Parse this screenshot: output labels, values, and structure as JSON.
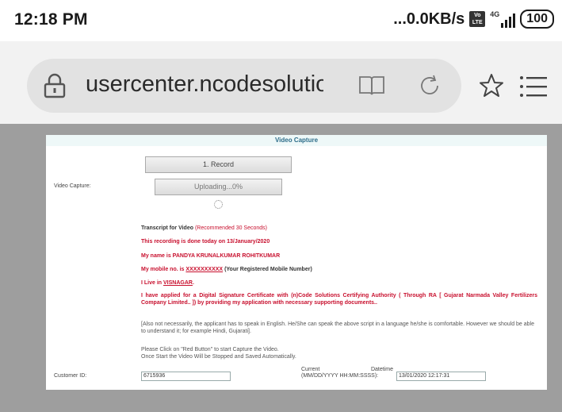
{
  "status_bar": {
    "time": "12:18 PM",
    "speed": "...0.0KB/s",
    "volte": "Vo LTE",
    "network": "4G",
    "battery": "100"
  },
  "browser": {
    "url": "usercenter.ncodesolutions.com"
  },
  "page": {
    "header": "Video Capture",
    "record_button": "1. Record",
    "video_capture_label": "Video Capture:",
    "upload_button": "Uploading...0%",
    "transcript_title": "Transcript for Video",
    "transcript_note": "(Recommended 30 Seconds)",
    "line_date": "This recording is done today on 13/January/2020",
    "line_name": "My name is PANDYA KRUNALKUMAR ROHITKUMAR",
    "line_mobile_prefix": "My mobile no. is",
    "line_mobile_value": "XXXXXXXXXX",
    "line_mobile_suffix": "(Your Registered Mobile Number)",
    "line_live_prefix": "I Live in",
    "line_live_city": "VISNAGAR",
    "line_live_suffix": ".",
    "line_applied": "I have applied for a Digital Signature Certificate with (n)Code Solutions Certifying Authority ( Through RA [ Gujarat Narmada Valley Fertilizers Company Limited.. ]) by providing my application with necessary supporting documents..",
    "note_language": "[Also not necessarily, the applicant has to speak in English. He/She can speak the above script in a language he/she is comfortable. However we should be able to understand it; for example Hindi, Gujarati].",
    "instruction_1": "Please Click on \"Red Button\" to start Capture the Video.",
    "instruction_2": "Once Start the Video Will be Stopped and Saved Automatically.",
    "customer_id_label": "Customer ID:",
    "customer_id_value": "6715936",
    "datetime_label_1": "Current",
    "datetime_label_2": "Datetime",
    "datetime_label_3": "(MM/DD/YYYY HH:MM:SSSS):",
    "datetime_value": "13/01/2020 12:17:31"
  }
}
